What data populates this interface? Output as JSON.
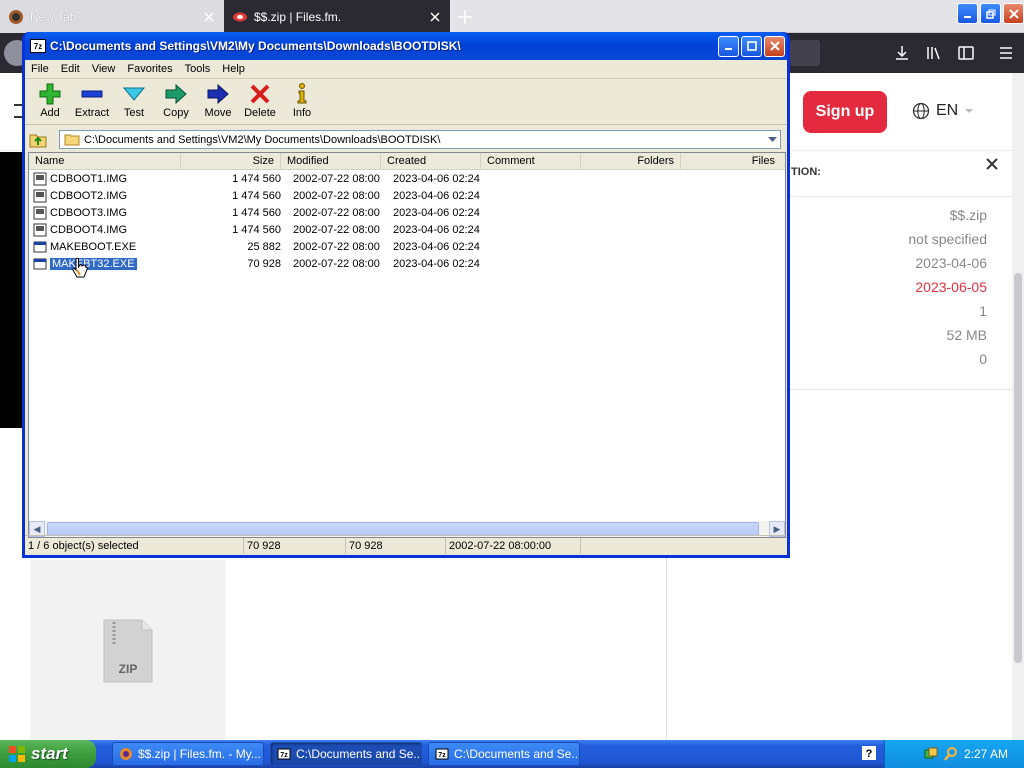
{
  "browser": {
    "tabs": [
      {
        "label": "New Tab"
      },
      {
        "label": "$$.zip | Files.fm."
      }
    ],
    "signup_label": "Sign up",
    "language": "EN"
  },
  "info_panel": {
    "title": "TION:",
    "filename": "$$.zip",
    "field2": "not specified",
    "created": "2023-04-06",
    "expires": "2023-06-05",
    "count": "1",
    "size": "52 MB",
    "downloads": "0"
  },
  "zip_icon_label": "ZIP",
  "sevenzip": {
    "title": "C:\\Documents and Settings\\VM2\\My Documents\\Downloads\\BOOTDISK\\",
    "menu": [
      "File",
      "Edit",
      "View",
      "Favorites",
      "Tools",
      "Help"
    ],
    "toolbar": [
      {
        "label": "Add",
        "icon": "add-icon"
      },
      {
        "label": "Extract",
        "icon": "extract-icon"
      },
      {
        "label": "Test",
        "icon": "test-icon"
      },
      {
        "label": "Copy",
        "icon": "copy-icon"
      },
      {
        "label": "Move",
        "icon": "move-icon"
      },
      {
        "label": "Delete",
        "icon": "delete-icon"
      },
      {
        "label": "Info",
        "icon": "info-icon"
      }
    ],
    "address": "C:\\Documents and Settings\\VM2\\My Documents\\Downloads\\BOOTDISK\\",
    "columns": [
      "Name",
      "Size",
      "Modified",
      "Created",
      "Comment",
      "Folders",
      "Files"
    ],
    "files": [
      {
        "name": "CDBOOT1.IMG",
        "size": "1 474 560",
        "modified": "2002-07-22 08:00",
        "created": "2023-04-06 02:24",
        "type": "img"
      },
      {
        "name": "CDBOOT2.IMG",
        "size": "1 474 560",
        "modified": "2002-07-22 08:00",
        "created": "2023-04-06 02:24",
        "type": "img"
      },
      {
        "name": "CDBOOT3.IMG",
        "size": "1 474 560",
        "modified": "2002-07-22 08:00",
        "created": "2023-04-06 02:24",
        "type": "img"
      },
      {
        "name": "CDBOOT4.IMG",
        "size": "1 474 560",
        "modified": "2002-07-22 08:00",
        "created": "2023-04-06 02:24",
        "type": "img"
      },
      {
        "name": "MAKEBOOT.EXE",
        "size": "25 882",
        "modified": "2002-07-22 08:00",
        "created": "2023-04-06 02:24",
        "type": "exe"
      },
      {
        "name": "MAKEBT32.EXE",
        "size": "70 928",
        "modified": "2002-07-22 08:00",
        "created": "2023-04-06 02:24",
        "type": "exe",
        "selected": true
      }
    ],
    "status": {
      "selection": "1 / 6 object(s) selected",
      "size": "70 928",
      "packed": "70 928",
      "modified": "2002-07-22 08:00:00"
    }
  },
  "taskbar": {
    "start_label": "start",
    "tasks": [
      {
        "label": "$$.zip | Files.fm. - My..."
      },
      {
        "label": "C:\\Documents and Se..."
      },
      {
        "label": "C:\\Documents and Se..."
      }
    ],
    "clock": "2:27 AM"
  }
}
